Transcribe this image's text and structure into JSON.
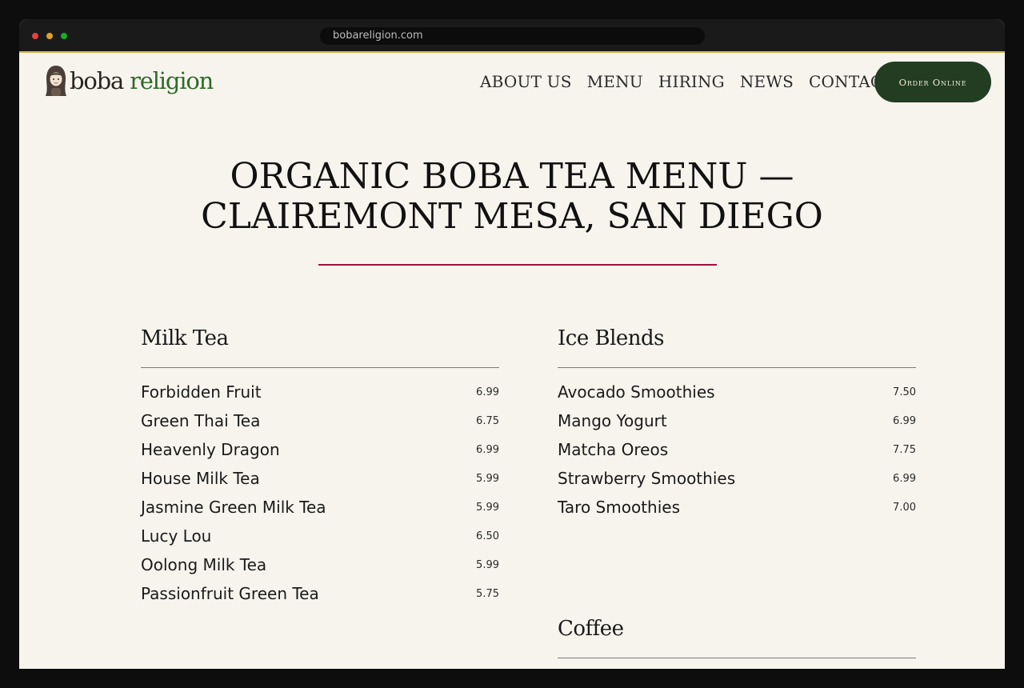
{
  "browser": {
    "url": "bobareligion.com"
  },
  "header": {
    "logo": {
      "word1": "boba",
      "word2": "religion"
    },
    "nav": [
      "ABOUT US",
      "MENU",
      "HIRING",
      "NEWS",
      "CONTACT"
    ],
    "order_button": "Order Online"
  },
  "page": {
    "title_line1": "Organic Boba Tea Menu —",
    "title_line2": "Clairemont Mesa, San Diego"
  },
  "menu": {
    "milk_tea": {
      "heading": "Milk Tea",
      "items": [
        {
          "name": "Forbidden Fruit",
          "price": "6.99"
        },
        {
          "name": "Green Thai Tea",
          "price": "6.75"
        },
        {
          "name": "Heavenly Dragon",
          "price": "6.99"
        },
        {
          "name": "House Milk Tea",
          "price": "5.99"
        },
        {
          "name": "Jasmine Green Milk Tea",
          "price": "5.99"
        },
        {
          "name": "Lucy Lou",
          "price": "6.50"
        },
        {
          "name": "Oolong Milk Tea",
          "price": "5.99"
        },
        {
          "name": "Passionfruit Green Tea",
          "price": "5.75"
        }
      ]
    },
    "ice_blends": {
      "heading": "Ice Blends",
      "items": [
        {
          "name": "Avocado Smoothies",
          "price": "7.50"
        },
        {
          "name": "Mango Yogurt",
          "price": "6.99"
        },
        {
          "name": "Matcha Oreos",
          "price": "7.75"
        },
        {
          "name": "Strawberry Smoothies",
          "price": "6.99"
        },
        {
          "name": "Taro Smoothies",
          "price": "7.00"
        }
      ]
    },
    "coffee": {
      "heading": "Coffee"
    }
  }
}
